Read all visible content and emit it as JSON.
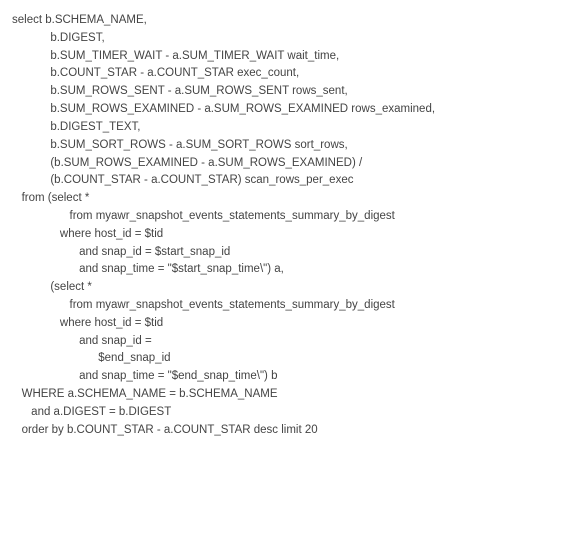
{
  "lines": [
    {
      "indent": 0,
      "text": "select b.SCHEMA_NAME,"
    },
    {
      "indent": 4,
      "text": "b.DIGEST,"
    },
    {
      "indent": 4,
      "text": "b.SUM_TIMER_WAIT - a.SUM_TIMER_WAIT wait_time,"
    },
    {
      "indent": 4,
      "text": "b.COUNT_STAR - a.COUNT_STAR exec_count,"
    },
    {
      "indent": 4,
      "text": "b.SUM_ROWS_SENT - a.SUM_ROWS_SENT rows_sent,"
    },
    {
      "indent": 4,
      "text": "b.SUM_ROWS_EXAMINED - a.SUM_ROWS_EXAMINED rows_examined,"
    },
    {
      "indent": 4,
      "text": "b.DIGEST_TEXT,"
    },
    {
      "indent": 4,
      "text": "b.SUM_SORT_ROWS - a.SUM_SORT_ROWS sort_rows,"
    },
    {
      "indent": 4,
      "text": "(b.SUM_ROWS_EXAMINED - a.SUM_ROWS_EXAMINED) /"
    },
    {
      "indent": 4,
      "text": "(b.COUNT_STAR - a.COUNT_STAR) scan_rows_per_exec"
    },
    {
      "indent": 1,
      "text": "from (select *"
    },
    {
      "indent": 6,
      "text": "from myawr_snapshot_events_statements_summary_by_digest"
    },
    {
      "indent": 5,
      "text": "where host_id = $tid"
    },
    {
      "indent": 7,
      "text": "and snap_id = $start_snap_id"
    },
    {
      "indent": 7,
      "text": "and snap_time = \"$start_snap_time\\\") a,"
    },
    {
      "indent": 4,
      "text": "(select *"
    },
    {
      "indent": 6,
      "text": "from myawr_snapshot_events_statements_summary_by_digest"
    },
    {
      "indent": 5,
      "text": "where host_id = $tid"
    },
    {
      "indent": 7,
      "text": "and snap_id ="
    },
    {
      "indent": 9,
      "text": "$end_snap_id"
    },
    {
      "indent": 7,
      "text": "and snap_time = \"$end_snap_time\\\") b"
    },
    {
      "indent": 1,
      "text": "WHERE a.SCHEMA_NAME = b.SCHEMA_NAME"
    },
    {
      "indent": 2,
      "text": "and a.DIGEST = b.DIGEST"
    },
    {
      "indent": 1,
      "text": "order by b.COUNT_STAR - a.COUNT_STAR desc limit 20"
    }
  ]
}
